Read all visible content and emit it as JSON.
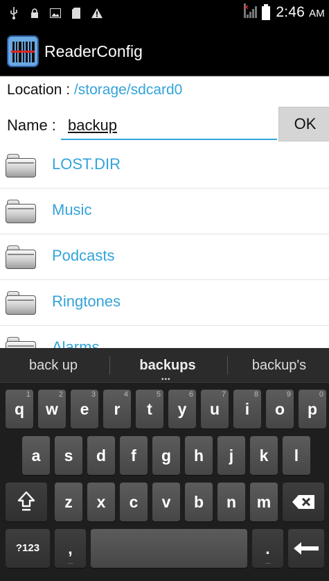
{
  "status_bar": {
    "icons_left": [
      "usb-icon",
      "lock-icon",
      "image-icon",
      "sd-card-icon",
      "warning-icon"
    ],
    "time": "2:46",
    "ampm": "AM"
  },
  "action_bar": {
    "title": "ReaderConfig",
    "app_icon": "barcode-reader-icon"
  },
  "location": {
    "label": "Location :",
    "path": "/storage/sdcard0"
  },
  "name_field": {
    "label": "Name :",
    "value": "backup"
  },
  "ok_button": "OK",
  "folders": [
    {
      "label": "LOST.DIR"
    },
    {
      "label": "Music"
    },
    {
      "label": "Podcasts"
    },
    {
      "label": "Ringtones"
    },
    {
      "label": "Alarms"
    }
  ],
  "keyboard": {
    "suggestions": [
      "back up",
      "backups",
      "backup's"
    ],
    "row1": [
      {
        "key": "q",
        "hint": "1"
      },
      {
        "key": "w",
        "hint": "2"
      },
      {
        "key": "e",
        "hint": "3"
      },
      {
        "key": "r",
        "hint": "4"
      },
      {
        "key": "t",
        "hint": "5"
      },
      {
        "key": "y",
        "hint": "6"
      },
      {
        "key": "u",
        "hint": "7"
      },
      {
        "key": "i",
        "hint": "8"
      },
      {
        "key": "o",
        "hint": "9"
      },
      {
        "key": "p",
        "hint": "0"
      }
    ],
    "row2": [
      "a",
      "s",
      "d",
      "f",
      "g",
      "h",
      "j",
      "k",
      "l"
    ],
    "row3": [
      "z",
      "x",
      "c",
      "v",
      "b",
      "n",
      "m"
    ],
    "symbols_key": "?123",
    "comma_key": ",",
    "period_key": ".",
    "shift_icon": "shift-icon",
    "backspace_icon": "backspace-icon",
    "enter_icon": "enter-icon"
  },
  "colors": {
    "accent": "#33a3db",
    "content_bg": "#ffffff",
    "keyboard_bg": "#1e1e1e"
  }
}
